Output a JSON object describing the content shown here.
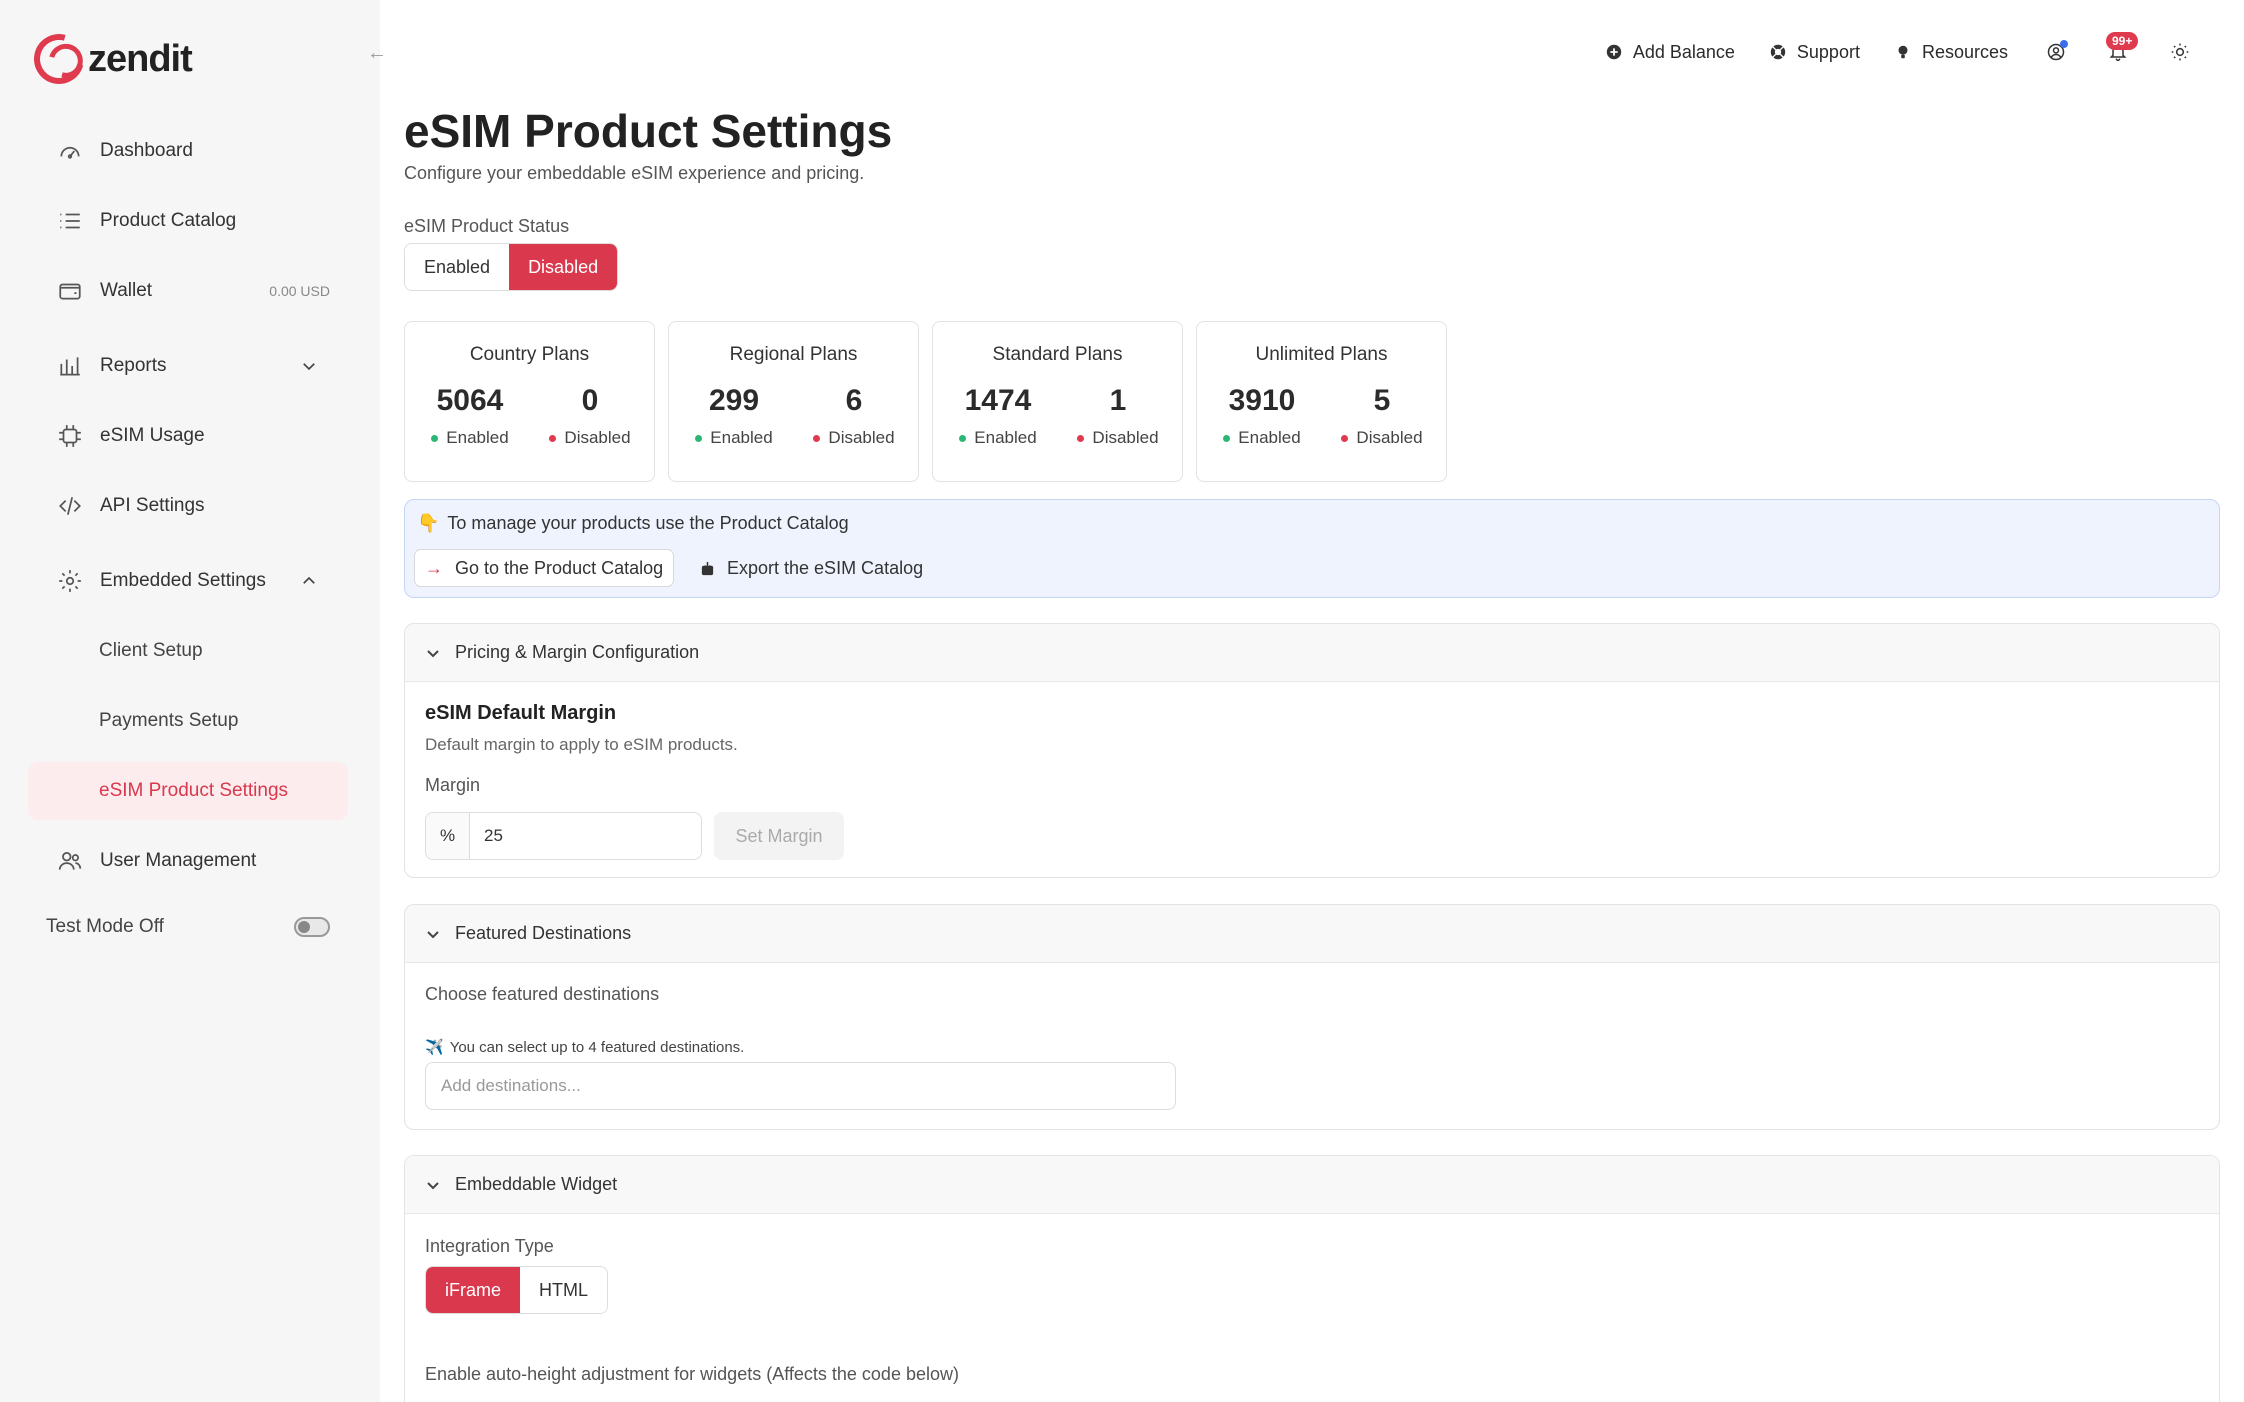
{
  "brand": {
    "name": "zendit",
    "accent": "#d9384d"
  },
  "sidebar": {
    "items": [
      {
        "label": "Dashboard",
        "icon": "gauge-icon"
      },
      {
        "label": "Product Catalog",
        "icon": "list-icon"
      },
      {
        "label": "Wallet",
        "icon": "wallet-icon",
        "meta": "0.00 USD"
      },
      {
        "label": "Reports",
        "icon": "bar-chart-icon"
      },
      {
        "label": "eSIM Usage",
        "icon": "chip-icon"
      },
      {
        "label": "API Settings",
        "icon": "code-icon"
      },
      {
        "label": "Embedded Settings",
        "icon": "gear-icon"
      }
    ],
    "subitems": [
      {
        "label": "Client Setup"
      },
      {
        "label": "Payments Setup"
      },
      {
        "label": "eSIM Product Settings",
        "active": true
      }
    ],
    "user_management": {
      "label": "User Management",
      "icon": "users-icon"
    },
    "test_mode": {
      "label": "Test Mode Off",
      "on": false
    }
  },
  "topbar": {
    "add_balance": "Add Balance",
    "support": "Support",
    "resources": "Resources",
    "notifications_badge": "99+"
  },
  "page": {
    "title": "eSIM Product Settings",
    "subtitle": "Configure your embeddable eSIM experience and pricing.",
    "status_label": "eSIM Product Status",
    "status_options": [
      "Enabled",
      "Disabled"
    ],
    "status_selected": "Disabled"
  },
  "plans": [
    {
      "title": "Country Plans",
      "enabled": "5064",
      "disabled": "0"
    },
    {
      "title": "Regional Plans",
      "enabled": "299",
      "disabled": "6"
    },
    {
      "title": "Standard Plans",
      "enabled": "1474",
      "disabled": "1"
    },
    {
      "title": "Unlimited Plans",
      "enabled": "3910",
      "disabled": "5"
    }
  ],
  "labels": {
    "enabled": "Enabled",
    "disabled": "Disabled"
  },
  "info": {
    "emoji": "👇",
    "text": "To manage your products use the Product Catalog",
    "go_catalog": "Go to the Product Catalog",
    "export_catalog": "Export the eSIM Catalog"
  },
  "pricing": {
    "header": "Pricing & Margin Configuration",
    "heading": "eSIM Default Margin",
    "description": "Default margin to apply to eSIM products.",
    "margin_label": "Margin",
    "margin_prefix": "%",
    "margin_value": "25",
    "set_margin": "Set Margin"
  },
  "featured": {
    "header": "Featured Destinations",
    "label": "Choose featured destinations",
    "hint_emoji": "✈️",
    "hint": "You can select up to 4 featured destinations.",
    "placeholder": "Add destinations..."
  },
  "widget": {
    "header": "Embeddable Widget",
    "integration_label": "Integration Type",
    "integration_options": [
      "iFrame",
      "HTML"
    ],
    "integration_selected": "iFrame",
    "auto_height": "Enable auto-height adjustment for widgets (Affects the code below)"
  }
}
